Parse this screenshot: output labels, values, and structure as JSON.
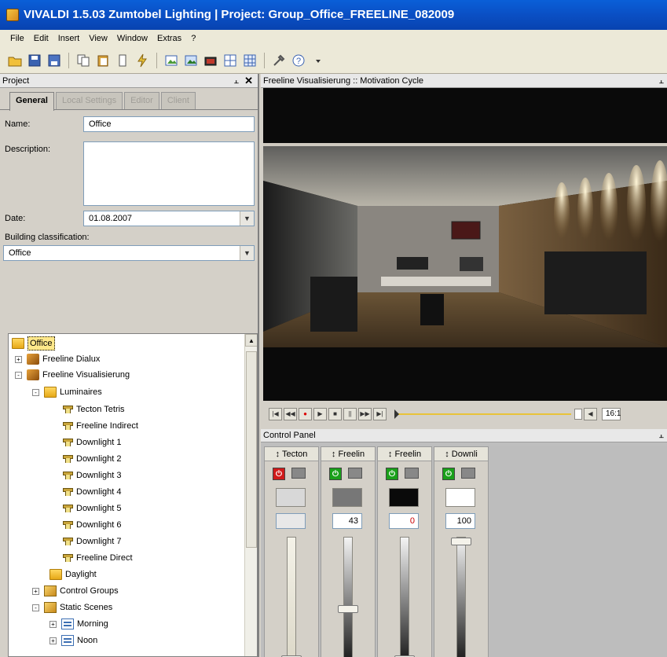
{
  "window": {
    "title": "VIVALDI 1.5.03 Zumtobel Lighting | Project: Group_Office_FREELINE_082009"
  },
  "menu": [
    "File",
    "Edit",
    "Insert",
    "View",
    "Window",
    "Extras",
    "?"
  ],
  "toolbar_icons": [
    "open-folder-icon",
    "save-icon",
    "save-as-icon",
    "copy-icon",
    "paste-icon",
    "page-icon",
    "lightning-icon",
    "image-icon",
    "image-alt-icon",
    "render-icon",
    "grid-icon",
    "grid-alt-icon",
    "tools-icon",
    "help-icon",
    "dropdown-icon"
  ],
  "project_panel": {
    "title": "Project",
    "pin": "⫠",
    "close": "✕",
    "tabs": [
      "General",
      "Local Settings",
      "Editor",
      "Client"
    ],
    "name_label": "Name:",
    "name_value": "Office",
    "description_label": "Description:",
    "date_label": "Date:",
    "date_value": "01.08.2007",
    "building_label": "Building classification:",
    "building_value": "Office"
  },
  "tree": {
    "root": "Office",
    "items": [
      {
        "label": "Freeline Dialux",
        "exp": "+"
      },
      {
        "label": "Freeline Visualisierung",
        "exp": "-"
      },
      {
        "label": "Luminaires",
        "exp": "-"
      },
      {
        "label": "Tecton Tetris"
      },
      {
        "label": "Freeline Indirect"
      },
      {
        "label": "Downlight 1"
      },
      {
        "label": "Downlight 2"
      },
      {
        "label": "Downlight 3"
      },
      {
        "label": "Downlight 4"
      },
      {
        "label": "Downlight 5"
      },
      {
        "label": "Downlight 6"
      },
      {
        "label": "Downlight 7"
      },
      {
        "label": "Freeline Direct"
      },
      {
        "label": "Daylight"
      },
      {
        "label": "Control Groups",
        "exp": "+"
      },
      {
        "label": "Static Scenes",
        "exp": "-"
      },
      {
        "label": "Morning",
        "exp": "+"
      },
      {
        "label": "Noon",
        "exp": "+"
      }
    ]
  },
  "viewer": {
    "title": "Freeline Visualisierung :: Motivation Cycle",
    "pin": "⫠"
  },
  "playback": {
    "buttons": [
      "|◀",
      "◀◀",
      "●",
      "▶",
      "■",
      "||",
      "▶▶",
      "▶|"
    ],
    "time": "16:1"
  },
  "control_panel": {
    "title": "Control Panel",
    "pin": "⫠",
    "channels": [
      {
        "name": "↕ Tecton",
        "state": "off",
        "value": "",
        "swatch": "#d8d8d8",
        "level": 0.0
      },
      {
        "name": "↕ Freelin",
        "state": "on",
        "value": "43",
        "swatch": "#777777",
        "level": 0.43
      },
      {
        "name": "↕ Freelin",
        "state": "on",
        "value": "0",
        "swatch": "#0a0a0a",
        "level": 0.0
      },
      {
        "name": "↕ Downli",
        "state": "on",
        "value": "100",
        "swatch": "#ffffff",
        "level": 1.0
      }
    ]
  },
  "colors": {
    "titlebar": "#0a4fc4",
    "on": "#1aa01a",
    "off": "#d01a1a",
    "tree_select": "#ffe88a"
  }
}
